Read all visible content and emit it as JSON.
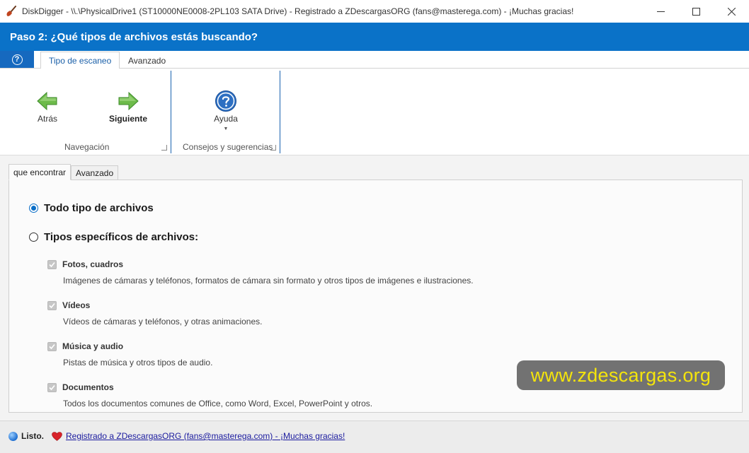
{
  "window": {
    "title": "DiskDigger - \\\\.\\PhysicalDrive1 (ST10000NE0008-2PL103 SATA Drive) - Registrado a ZDescargasORG (fans@masterega.com) - ¡Muchas gracias!"
  },
  "header": {
    "step_title": "Paso 2: ¿Qué tipos de archivos estás buscando?"
  },
  "ribbon": {
    "help_tab": "?",
    "tabs": [
      {
        "label": "Tipo de escaneo"
      },
      {
        "label": "Avanzado"
      }
    ],
    "groups": [
      {
        "label": "Navegación",
        "buttons": [
          {
            "label": "Atrás",
            "icon": "arrow-left-icon"
          },
          {
            "label": "Siguiente",
            "icon": "arrow-right-icon"
          }
        ]
      },
      {
        "label": "Consejos y sugerencias",
        "buttons": [
          {
            "label": "Ayuda",
            "icon": "help-icon"
          }
        ]
      }
    ]
  },
  "content_tabs": [
    {
      "label": "que encontrar"
    },
    {
      "label": "Avanzado"
    }
  ],
  "options": {
    "all_types": {
      "label": "Todo tipo de archivos",
      "selected": true
    },
    "specific_types": {
      "label": "Tipos específicos de archivos:",
      "selected": false
    }
  },
  "categories": [
    {
      "title": "Fotos, cuadros",
      "desc": "Imágenes de cámaras y teléfonos, formatos de cámara sin formato y otros tipos de imágenes e ilustraciones.",
      "checked": true,
      "disabled": true
    },
    {
      "title": "Vídeos",
      "desc": "Vídeos de cámaras y teléfonos, y otras animaciones.",
      "checked": true,
      "disabled": true
    },
    {
      "title": "Música y audio",
      "desc": "Pistas de música y otros tipos de audio.",
      "checked": true,
      "disabled": true
    },
    {
      "title": "Documentos",
      "desc": "Todos los documentos comunes de Office, como Word, Excel, PowerPoint y otros.",
      "checked": true,
      "disabled": true
    }
  ],
  "watermark": {
    "text": "www.zdescargas.org"
  },
  "status": {
    "text": "Listo.",
    "link": "Registrado a ZDescargasORG (fans@masterega.com) - ¡Muchas gracias!"
  },
  "colors": {
    "header_bg": "#0a72c8",
    "accent_blue": "#1669bf",
    "separator": "#1a63b0",
    "arrow_green": "#55a83a",
    "watermark_text": "#f4e40c"
  }
}
